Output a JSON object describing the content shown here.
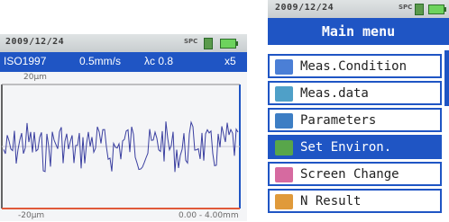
{
  "left_screen": {
    "date": "2009/12/24",
    "spc": "SPC",
    "params": {
      "standard": "ISO1997",
      "speed": "0.5mm/s",
      "cutoff": "λc 0.8",
      "count": "x5"
    },
    "plot": {
      "y_top_label": "20μm",
      "y_bottom_label": "-20μm",
      "x_range_label": "0.00 - 4.00mm"
    },
    "colors": {
      "header": "#1f55c4",
      "trace": "#3a3fa0",
      "baseline": "#e05a3a"
    }
  },
  "right_screen": {
    "date": "2009/12/24",
    "spc": "SPC",
    "title": "Main menu",
    "menu_items": [
      {
        "label": "Meas.Condition",
        "icon": "meas-condition-icon",
        "icon_color": "#4b7fd6",
        "selected": false
      },
      {
        "label": "Meas.data",
        "icon": "meas-data-icon",
        "icon_color": "#4fa0c8",
        "selected": false
      },
      {
        "label": "Parameters",
        "icon": "parameters-icon",
        "icon_color": "#3d7ec4",
        "selected": false
      },
      {
        "label": "Set Environ.",
        "icon": "set-environ-icon",
        "icon_color": "#58a64a",
        "selected": true
      },
      {
        "label": "Screen Change",
        "icon": "screen-change-icon",
        "icon_color": "#d66aa0",
        "selected": false
      },
      {
        "label": "N Result",
        "icon": "n-result-icon",
        "icon_color": "#e09a3a",
        "selected": false
      }
    ]
  }
}
